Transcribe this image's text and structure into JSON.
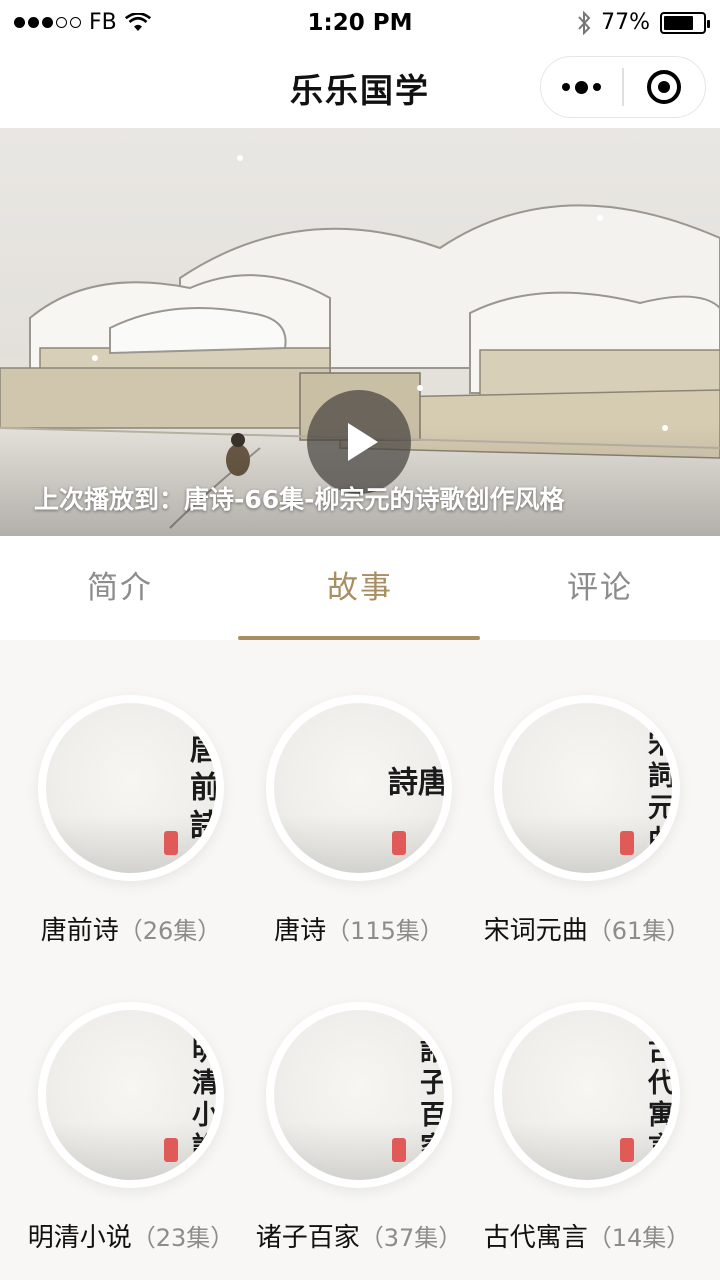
{
  "status_bar": {
    "carrier": "FB",
    "time": "1:20 PM",
    "battery": "77%",
    "battery_level": 0.77,
    "icons": [
      "signal-dots-icon",
      "wifi-icon",
      "bluetooth-icon",
      "battery-icon"
    ]
  },
  "nav": {
    "title": "乐乐国学",
    "icons": [
      "more-icon",
      "close-target-icon"
    ]
  },
  "banner": {
    "last_played": "上次播放到：唐诗-66集-柳宗元的诗歌创作风格",
    "icon": "play-icon"
  },
  "tabs": [
    {
      "label": "简介",
      "active": false
    },
    {
      "label": "故事",
      "active": true
    },
    {
      "label": "评论",
      "active": false
    }
  ],
  "accent_color": "#a88e62",
  "categories": [
    {
      "title": "唐前诗",
      "count": "（26集）",
      "art": "唐前詩"
    },
    {
      "title": "唐诗",
      "count": "（115集）",
      "art": "唐詩"
    },
    {
      "title": "宋词元曲",
      "count": "（61集）",
      "art": "宋詞元曲"
    },
    {
      "title": "明清小说",
      "count": "（23集）",
      "art": "明清小說"
    },
    {
      "title": "诸子百家",
      "count": "（37集）",
      "art": "諸子百家"
    },
    {
      "title": "古代寓言",
      "count": "（14集）",
      "art": "古代寓言"
    }
  ]
}
